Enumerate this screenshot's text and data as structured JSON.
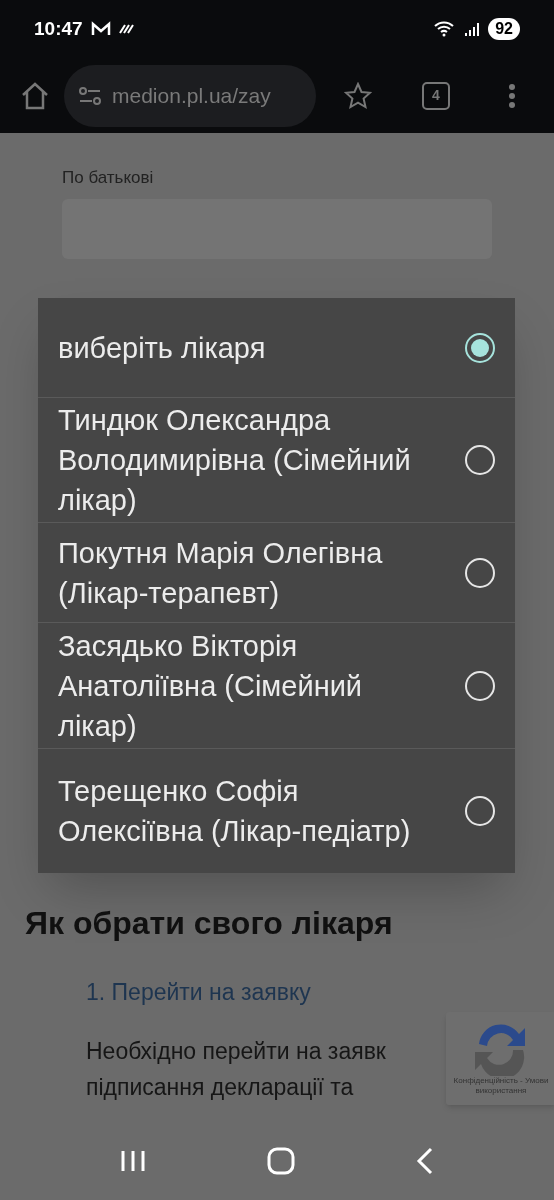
{
  "status_bar": {
    "time": "10:47",
    "battery": "92"
  },
  "browser": {
    "url": "medion.pl.ua/zay",
    "tab_count": "4"
  },
  "form": {
    "field_label": "По батькові"
  },
  "dialog": {
    "options": [
      {
        "label": "виберіть лікаря",
        "selected": true
      },
      {
        "label": "Тиндюк Олександра Володимирівна (Сімейний лікар)",
        "selected": false
      },
      {
        "label": "Покутня Марія Олегівна (Лікар-терапевт)",
        "selected": false
      },
      {
        "label": "Засядько Вікторія Анатоліївна (Сімейний лікар)",
        "selected": false
      },
      {
        "label": "Терещенко Софія Олексіївна (Лікар-педіатр)",
        "selected": false
      }
    ]
  },
  "article": {
    "heading": "Як обрати свого лікаря",
    "step": "1. Перейти на заявку",
    "paragraph_lines": [
      "Необхідно перейти на заявк",
      "підписання декларації та"
    ]
  },
  "recaptcha": {
    "links": "Конфіденційність - Умови використання"
  }
}
